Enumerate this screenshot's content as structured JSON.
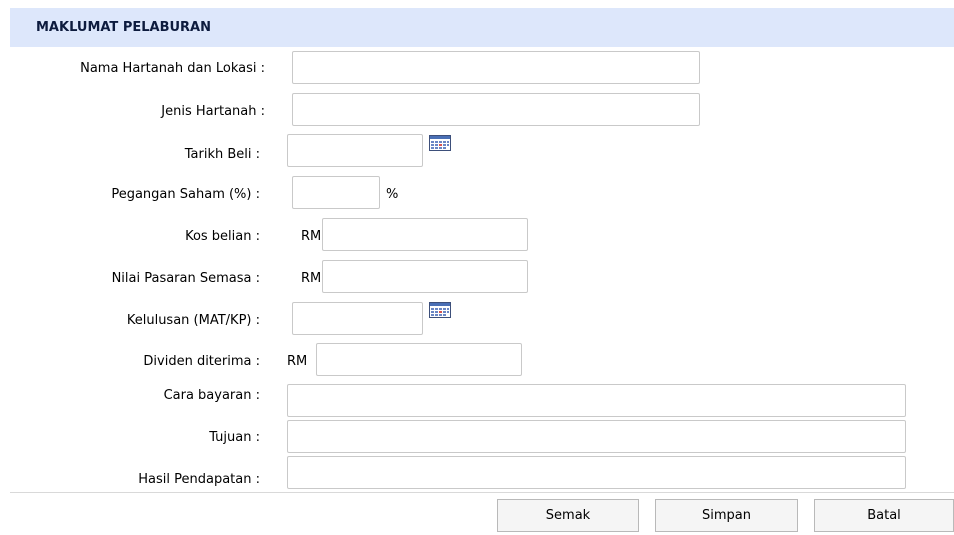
{
  "section": {
    "title": "MAKLUMAT PELABURAN"
  },
  "fields": {
    "nama": {
      "label": "Nama Hartanah dan Lokasi :",
      "value": ""
    },
    "jenis": {
      "label": "Jenis Hartanah :",
      "value": ""
    },
    "tarikh": {
      "label": "Tarikh Beli :",
      "value": ""
    },
    "pegangan": {
      "label": "Pegangan Saham (%) :",
      "value": "",
      "suffix": "%"
    },
    "kos": {
      "label": "Kos belian :",
      "prefix": "RM",
      "value": ""
    },
    "nilai": {
      "label": "Nilai Pasaran Semasa :",
      "prefix": "RM",
      "value": ""
    },
    "kelulusan": {
      "label": "Kelulusan (MAT/KP) :",
      "value": ""
    },
    "dividen": {
      "label": "Dividen diterima :",
      "prefix": "RM",
      "value": ""
    },
    "cara": {
      "label": "Cara bayaran :",
      "value": ""
    },
    "tujuan": {
      "label": "Tujuan :",
      "value": ""
    },
    "hasil": {
      "label": "Hasil Pendapatan :",
      "value": ""
    }
  },
  "buttons": {
    "semak": "Semak",
    "simpan": "Simpan",
    "batal": "Batal"
  },
  "icons": {
    "calendar": "calendar-icon"
  },
  "colors": {
    "header_bg": "#dde7fb",
    "header_text": "#0d1b3e"
  }
}
